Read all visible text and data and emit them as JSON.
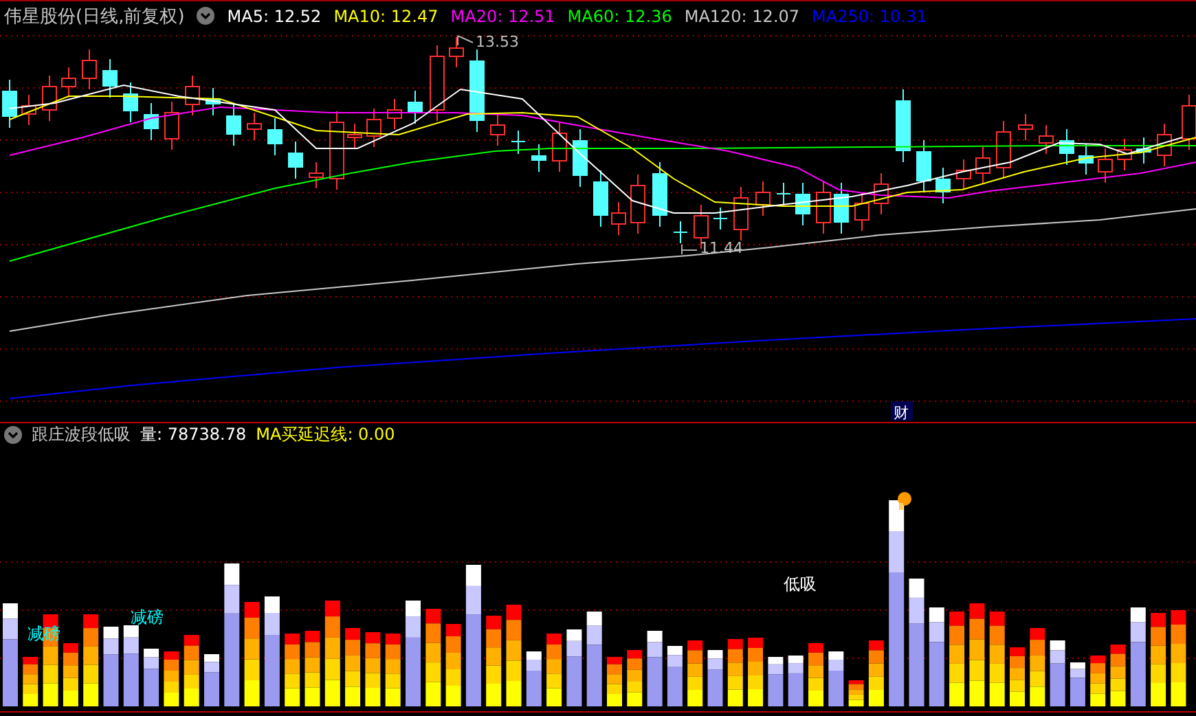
{
  "header": {
    "title": "伟星股份(日线,前复权)",
    "indicators": [
      {
        "label": "MA5: 12.52",
        "color": "#ffffff"
      },
      {
        "label": "MA10: 12.47",
        "color": "#ffff00"
      },
      {
        "label": "MA20: 12.51",
        "color": "#ff00ff"
      },
      {
        "label": "MA60: 12.36",
        "color": "#00ff00"
      },
      {
        "label": "MA120: 12.07",
        "color": "#c8c8c8"
      },
      {
        "label": "MA250: 10.31",
        "color": "#0000ff"
      }
    ]
  },
  "price_chart": {
    "annotations": [
      {
        "kind": "high",
        "text": "13.53"
      },
      {
        "kind": "low",
        "text": "11.44"
      }
    ],
    "event_badge": "财"
  },
  "indicator_panel": {
    "title": "跟庄波段低吸",
    "readings": [
      {
        "label": "量: 78738.78",
        "color": "#ffffff"
      },
      {
        "label": "MA买延迟线: 0.00",
        "color": "#ffff00"
      }
    ],
    "signals": [
      {
        "text": "减磅",
        "color": "#00ffff"
      },
      {
        "text": "减磅",
        "color": "#00ffff"
      },
      {
        "text": "低吸",
        "color": "#ffffff"
      }
    ]
  }
}
